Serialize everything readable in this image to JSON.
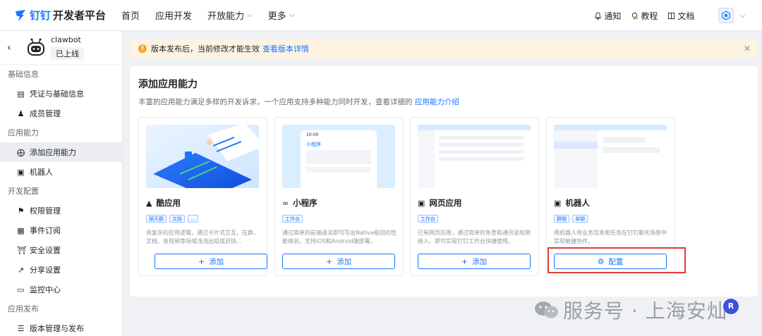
{
  "topbar": {
    "logo_brand": "钉钉",
    "logo_suffix": "开发者平台",
    "nav": [
      {
        "label": "首页"
      },
      {
        "label": "应用开发"
      },
      {
        "label": "开放能力"
      },
      {
        "label": "更多"
      }
    ],
    "right": {
      "notify": "通知",
      "tutorial": "教程",
      "docs": "文档"
    }
  },
  "sidebar": {
    "app_name": "clawbot",
    "app_status": "已上线",
    "sections": [
      {
        "title": "基础信息",
        "items": [
          "凭证与基础信息",
          "成员管理"
        ]
      },
      {
        "title": "应用能力",
        "items": [
          "添加应用能力",
          "机器人"
        ]
      },
      {
        "title": "开发配置",
        "items": [
          "权限管理",
          "事件订阅",
          "安全设置",
          "分享设置",
          "监控中心"
        ]
      },
      {
        "title": "应用发布",
        "items": [
          "版本管理与发布"
        ]
      }
    ]
  },
  "notice": {
    "text": "版本发布后，当前修改才能生效",
    "link": "查看版本详情"
  },
  "panel": {
    "title": "添加应用能力",
    "desc": "丰富的应用能力满足多样的开发诉求，一个应用支持多种能力同时开发，查看详细的",
    "desc_link": "应用能力介绍",
    "cards": [
      {
        "title": "酷应用",
        "tags": [
          "聊天群",
          "文档",
          "..."
        ],
        "desc": "将复杂的应用逻辑，通过卡片式交互，在群、文档、音视频等场域浅浅出组成员快...",
        "button": "添加",
        "thumb_text": "我的卡片"
      },
      {
        "title": "小程序",
        "tags": [
          "工作台"
        ],
        "desc": "通过简单的前端语法即可写出Native级别的性能体验，支持iOS和Android端部署。",
        "button": "添加",
        "thumb_text": "小程序",
        "thumb_time": "10:00"
      },
      {
        "title": "网页应用",
        "tags": [
          "工作台"
        ],
        "desc": "已有网页应用，通过简单的免登和通讯录权限接入，即可实现钉钉工作台快捷使用。",
        "button": "添加"
      },
      {
        "title": "机器人",
        "tags": [
          "群聊",
          "单聊"
        ],
        "desc": "用机器人将业务信息和任务在钉钉聊天场景中实现敏捷协作。",
        "button": "配置"
      }
    ]
  },
  "watermark": {
    "text": "服务号 · 上海安灿",
    "badge": "R"
  },
  "colors": {
    "primary": "#1677ff",
    "highlight": "#e53935",
    "notice_bg": "#fdf3e2",
    "warn": "#f5a623"
  }
}
